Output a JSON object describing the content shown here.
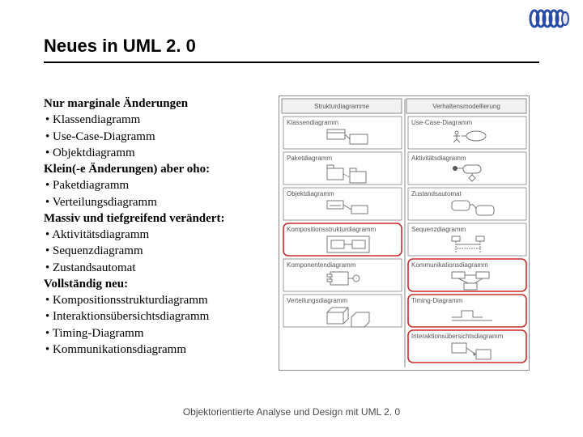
{
  "title": "Neues in UML 2. 0",
  "sections": [
    {
      "heading": "Nur marginale Änderungen",
      "items": [
        "Klassendiagramm",
        "Use-Case-Diagramm",
        "Objektdiagramm"
      ]
    },
    {
      "heading": "Klein(-e Änderungen) aber oho:",
      "items": [
        "Paketdiagramm",
        "Verteilungsdiagramm"
      ]
    },
    {
      "heading": "Massiv und tiefgreifend verändert:",
      "items": [
        "Aktivitätsdiagramm",
        "Sequenzdiagramm",
        "Zustandsautomat"
      ]
    },
    {
      "heading": "Vollständig neu:",
      "items": [
        "Kompositionsstrukturdiagramm",
        "Interaktionsübersichtsdiagramm",
        "Timing-Diagramm",
        "Kommunikationsdiagramm"
      ]
    }
  ],
  "figure": {
    "col_left": "Strukturdiagramme",
    "col_right": "Verhaltensmodellierung",
    "cells": [
      [
        "Klassendiagramm",
        "Use-Case-Diagramm"
      ],
      [
        "Paketdiagramm",
        "Aktivitätsdiagramm"
      ],
      [
        "Objektdiagramm",
        "Zustandsautomat"
      ],
      [
        "Kompositionsstrukturdiagramm",
        "Sequenzdiagramm"
      ],
      [
        "Komponentendiagramm",
        "Kommunikationsdiagramm"
      ],
      [
        "Verteilungsdiagramm",
        "Timing-Diagramm"
      ],
      [
        "",
        "Interaktionsübersichtsdiagramm"
      ]
    ],
    "highlight_left": [
      3
    ],
    "highlight_right": [
      4,
      5,
      6
    ]
  },
  "footer": "Objektorientierte Analyse und Design mit UML 2. 0"
}
